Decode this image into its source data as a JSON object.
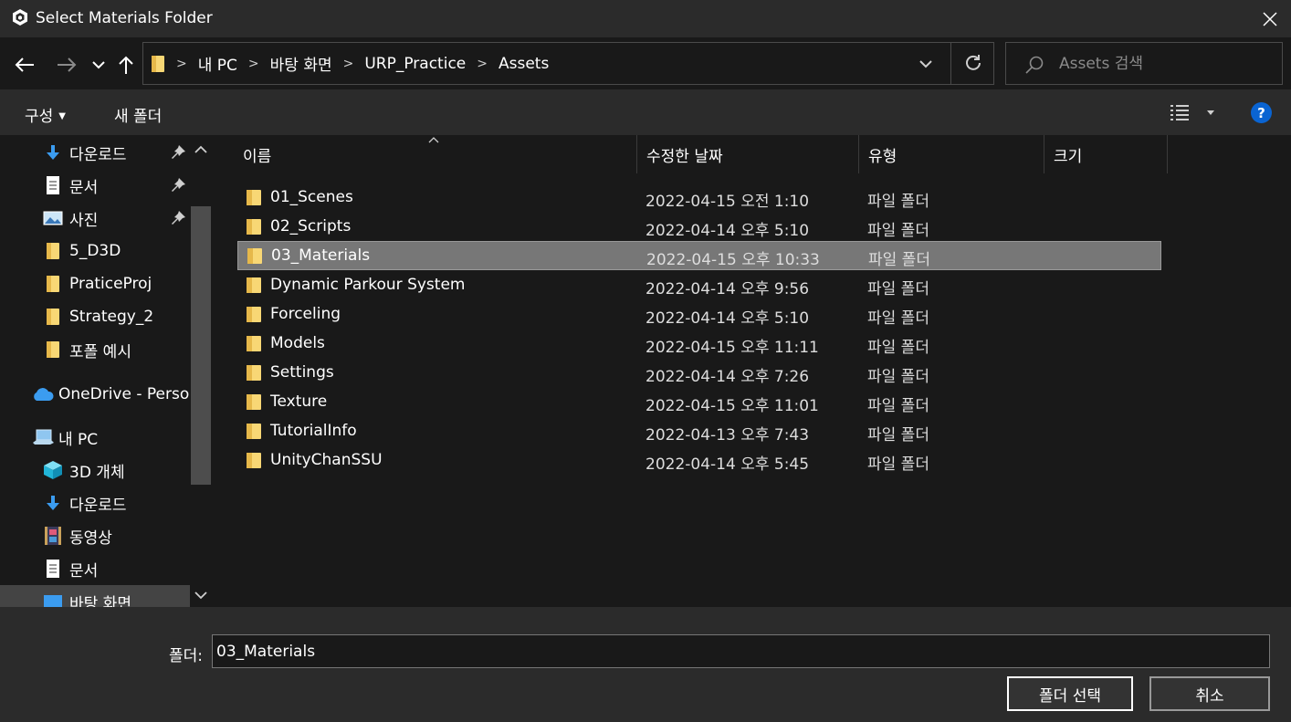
{
  "window": {
    "title": "Select Materials Folder"
  },
  "address": {
    "crumbs": [
      "내 PC",
      "바탕 화면",
      "URP_Practice",
      "Assets"
    ]
  },
  "search": {
    "placeholder": "Assets 검색"
  },
  "toolbar": {
    "organize_label": "구성",
    "new_folder_label": "새 폴더",
    "help_label": "?"
  },
  "sidebar": {
    "items": [
      {
        "label": "다운로드",
        "icon": "download-arrow-icon",
        "pinned": true
      },
      {
        "label": "문서",
        "icon": "document-icon",
        "pinned": true
      },
      {
        "label": "사진",
        "icon": "pictures-icon",
        "pinned": true
      },
      {
        "label": "5_D3D",
        "icon": "folder-icon",
        "pinned": false
      },
      {
        "label": "PraticeProj",
        "icon": "folder-icon",
        "pinned": false
      },
      {
        "label": "Strategy_2",
        "icon": "folder-icon",
        "pinned": false
      },
      {
        "label": "포폴 예시",
        "icon": "folder-icon",
        "pinned": false
      },
      {
        "label": "OneDrive - Persor",
        "icon": "onedrive-cloud-icon",
        "pinned": false
      },
      {
        "label": "내 PC",
        "icon": "this-pc-icon",
        "pinned": false
      },
      {
        "label": "3D 개체",
        "icon": "3d-objects-icon",
        "pinned": false
      },
      {
        "label": "다운로드",
        "icon": "download-arrow-icon",
        "pinned": false
      },
      {
        "label": "동영상",
        "icon": "videos-icon",
        "pinned": false
      },
      {
        "label": "문서",
        "icon": "document-icon",
        "pinned": false
      },
      {
        "label": "바탕 화면",
        "icon": "desktop-icon",
        "pinned": false
      }
    ]
  },
  "columns": {
    "name": "이름",
    "modified": "수정한 날짜",
    "type": "유형",
    "size": "크기"
  },
  "files": [
    {
      "name": "01_Scenes",
      "modified": "2022-04-15 오전 1:10",
      "type": "파일 폴더",
      "selected": false
    },
    {
      "name": "02_Scripts",
      "modified": "2022-04-14 오후 5:10",
      "type": "파일 폴더",
      "selected": false
    },
    {
      "name": "03_Materials",
      "modified": "2022-04-15 오후 10:33",
      "type": "파일 폴더",
      "selected": true
    },
    {
      "name": "Dynamic Parkour System",
      "modified": "2022-04-14 오후 9:56",
      "type": "파일 폴더",
      "selected": false
    },
    {
      "name": "Forceling",
      "modified": "2022-04-14 오후 5:10",
      "type": "파일 폴더",
      "selected": false
    },
    {
      "name": "Models",
      "modified": "2022-04-15 오후 11:11",
      "type": "파일 폴더",
      "selected": false
    },
    {
      "name": "Settings",
      "modified": "2022-04-14 오후 7:26",
      "type": "파일 폴더",
      "selected": false
    },
    {
      "name": "Texture",
      "modified": "2022-04-15 오후 11:01",
      "type": "파일 폴더",
      "selected": false
    },
    {
      "name": "TutorialInfo",
      "modified": "2022-04-13 오후 7:43",
      "type": "파일 폴더",
      "selected": false
    },
    {
      "name": "UnityChanSSU",
      "modified": "2022-04-14 오후 5:45",
      "type": "파일 폴더",
      "selected": false
    }
  ],
  "footer": {
    "folder_label": "폴더:",
    "folder_value": "03_Materials",
    "select_button": "폴더 선택",
    "cancel_button": "취소"
  },
  "colors": {
    "folder_yellow": "#f8d775",
    "accent_blue": "#0a64d2",
    "selection": "#777777"
  }
}
